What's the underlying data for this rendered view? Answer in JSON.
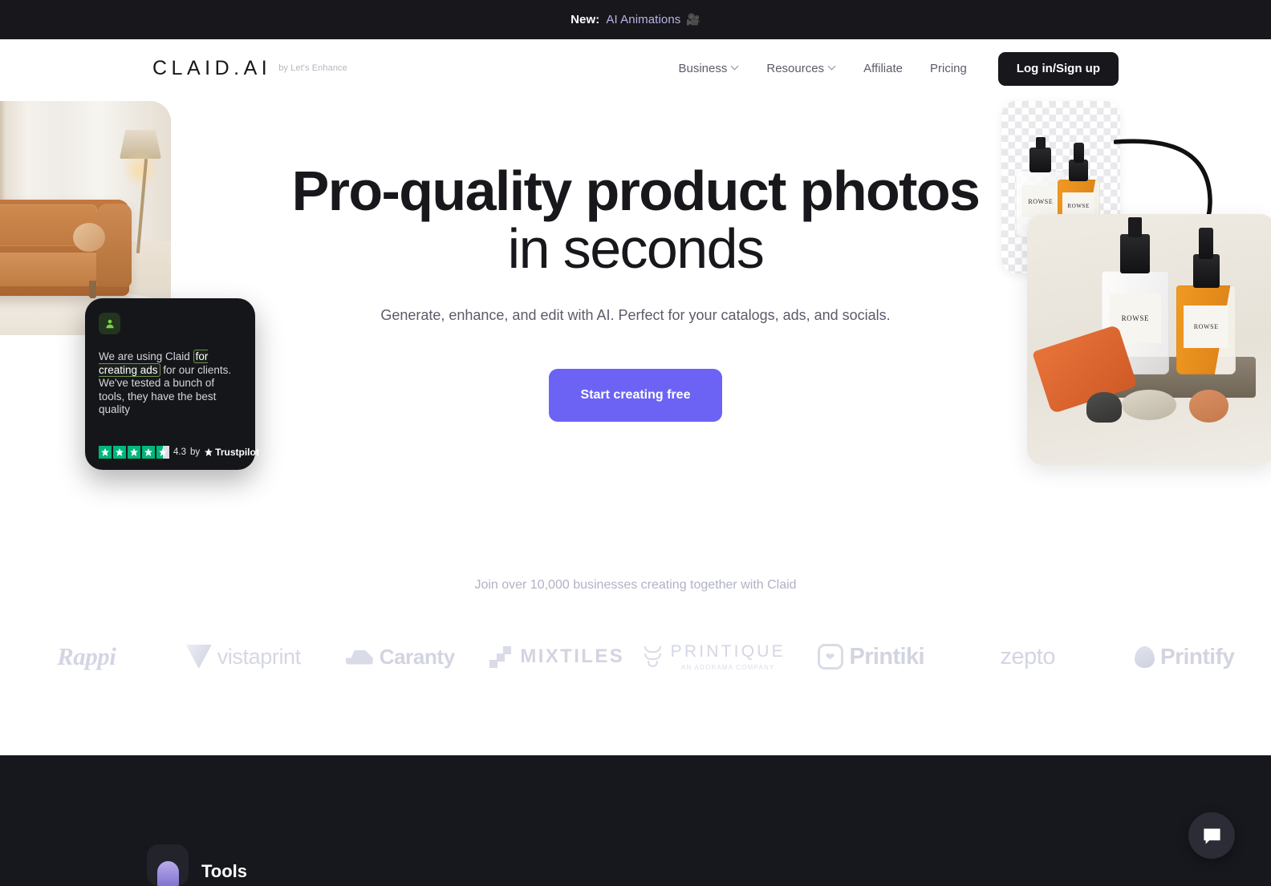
{
  "announcement": {
    "prefix": "New:",
    "link_text": "AI Animations",
    "icon": "movie-camera-emoji",
    "icon_glyph": "🎥"
  },
  "header": {
    "logo": {
      "wordmark": "CLAID.AI",
      "byline": "by Let's Enhance"
    },
    "nav": [
      {
        "label": "Business",
        "has_dropdown": true
      },
      {
        "label": "Resources",
        "has_dropdown": true
      },
      {
        "label": "Affiliate",
        "has_dropdown": false
      },
      {
        "label": "Pricing",
        "has_dropdown": false
      }
    ],
    "login_button": "Log in/Sign up"
  },
  "hero": {
    "headline_strong": "Pro-quality product photos",
    "headline_light": " in seconds",
    "subheadline": "Generate, enhance, and edit with AI. Perfect for your catalogs, ads, and socials.",
    "cta_label": "Start creating free",
    "cta_color": "#6c63f5"
  },
  "testimonial": {
    "avatar_icon": "person-icon",
    "quote_before": "We are using Claid ",
    "quote_highlight": "for creating ads",
    "quote_after": " for our clients. We've tested a bunch of tools, they have the best quality",
    "rating_value": "4.3",
    "rating_by": "by",
    "rating_source": "Trustpilot",
    "stars_full": 4,
    "stars_half": 1,
    "star_color": "#00b67a"
  },
  "hero_images": {
    "left_photo_alt": "Tan leather sofa in a bright living room with sheer curtains and a floor lamp",
    "cutout_card_alt": "ROWSE bottles on transparent checkerboard background",
    "scene_card_alt": "ROWSE bottles styled on a stone podium with rocks",
    "bottle_label": "ROWSE",
    "arrow_icon": "curved-arrow-icon"
  },
  "social_proof": {
    "join_text": "Join over 10,000 businesses creating together with Claid",
    "logos": [
      {
        "name": "Rappi"
      },
      {
        "name": "vistaprint"
      },
      {
        "name": "Caranty"
      },
      {
        "name": "MIXTILES"
      },
      {
        "name": "PRINTIQUE",
        "sub": "AN ADORAMA COMPANY"
      },
      {
        "name": "Printiki"
      },
      {
        "name": "zepto"
      },
      {
        "name": "Printify"
      }
    ]
  },
  "footer_section": {
    "tool_label": "Tools",
    "chat_icon": "chat-bubble-icon"
  }
}
